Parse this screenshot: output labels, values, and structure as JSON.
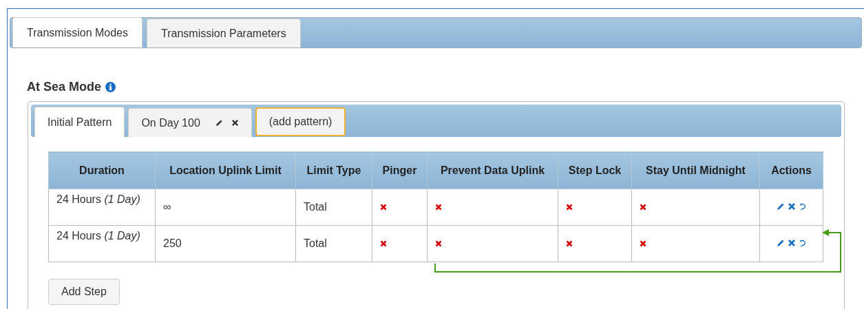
{
  "tabs": [
    {
      "label": "Transmission Modes",
      "selected": true
    },
    {
      "label": "Transmission Parameters",
      "selected": false
    }
  ],
  "section": {
    "title": "At Sea Mode"
  },
  "pattern_tabs": [
    {
      "label": "Initial Pattern",
      "selected": true,
      "kind": "pattern",
      "editable": false
    },
    {
      "label": "On Day 100",
      "selected": false,
      "kind": "pattern",
      "editable": true
    },
    {
      "label": "(add pattern)",
      "kind": "add"
    }
  ],
  "table": {
    "columns": [
      "Duration",
      "Location Uplink Limit",
      "Limit Type",
      "Pinger",
      "Prevent Data Uplink",
      "Step Lock",
      "Stay Until Midnight",
      "Actions"
    ],
    "rows": [
      {
        "duration": "24 Hours *(1 Day)*",
        "uplink_limit": "∞",
        "limit_type": "Total",
        "pinger": false,
        "prevent_data_uplink": false,
        "step_lock": false,
        "stay_until_midnight": false
      },
      {
        "duration": "24 Hours *(1 Day)*",
        "uplink_limit": "250",
        "limit_type": "Total",
        "pinger": false,
        "prevent_data_uplink": false,
        "step_lock": false,
        "stay_until_midnight": false
      }
    ]
  },
  "add_step_button": "Add Step"
}
